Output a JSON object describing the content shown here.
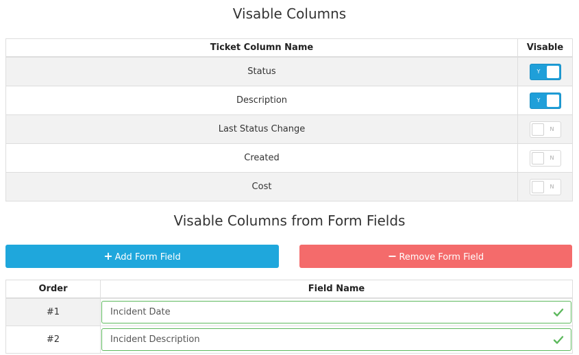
{
  "visible_columns": {
    "title": "Visable Columns",
    "headers": {
      "name": "Ticket Column Name",
      "visible": "Visable"
    },
    "rows": [
      {
        "name": "Status",
        "visible": "Y"
      },
      {
        "name": "Description",
        "visible": "Y"
      },
      {
        "name": "Last Status Change",
        "visible": "N"
      },
      {
        "name": "Created",
        "visible": "N"
      },
      {
        "name": "Cost",
        "visible": "N"
      }
    ]
  },
  "form_fields": {
    "title": "Visable Columns from Form Fields",
    "add_label": "Add Form Field",
    "remove_label": "Remove Form Field",
    "headers": {
      "order": "Order",
      "field": "Field Name"
    },
    "rows": [
      {
        "order": "#1",
        "field": "Incident Date"
      },
      {
        "order": "#2",
        "field": "Incident Description"
      }
    ]
  },
  "icons": {
    "add": "plus-icon",
    "remove": "minus-icon",
    "valid": "check-icon"
  },
  "colors": {
    "toggle_on": "#1f9fd9",
    "add_button": "#1fa7dc",
    "remove_button": "#f46b6b",
    "valid": "#5cb85c"
  }
}
